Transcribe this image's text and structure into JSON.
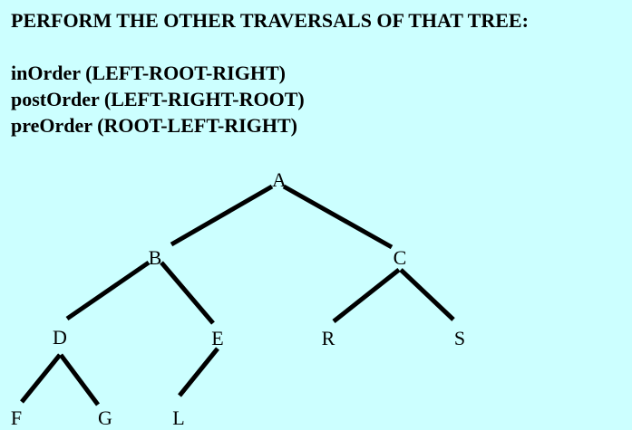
{
  "title": "PERFORM THE OTHER TRAVERSALS OF THAT TREE:",
  "traversals": [
    "inOrder (LEFT-ROOT-RIGHT)",
    "postOrder (LEFT-RIGHT-ROOT)",
    "preOrder (ROOT-LEFT-RIGHT)"
  ],
  "tree": {
    "nodes": {
      "A": "A",
      "B": "B",
      "C": "C",
      "D": "D",
      "E": "E",
      "R": "R",
      "S": "S",
      "F": "F",
      "G": "G",
      "L": "L"
    },
    "edges": [
      [
        "A",
        "B"
      ],
      [
        "A",
        "C"
      ],
      [
        "B",
        "D"
      ],
      [
        "B",
        "E"
      ],
      [
        "C",
        "R"
      ],
      [
        "C",
        "S"
      ],
      [
        "D",
        "F"
      ],
      [
        "D",
        "G"
      ],
      [
        "E",
        "L"
      ]
    ]
  },
  "colors": {
    "background": "#ccffff",
    "foreground": "#000000"
  }
}
